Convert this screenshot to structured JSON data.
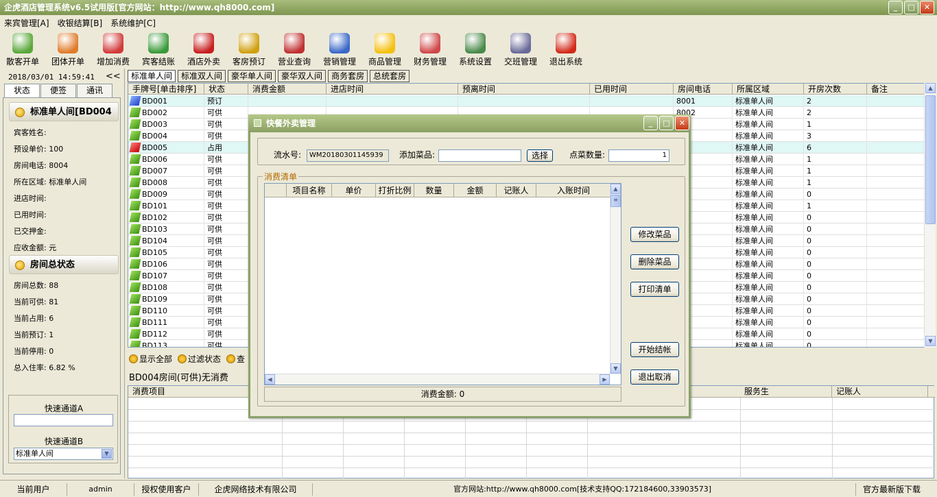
{
  "window": {
    "title": "企虎酒店管理系统v6.5试用版[官方网站：http://www.qh8000.com]"
  },
  "menu": [
    "来宾管理[A]",
    "收银结算[B]",
    "系统维护[C]"
  ],
  "toolbar": [
    {
      "label": "散客开单",
      "icon": "person-icon",
      "color": "#5aa83a"
    },
    {
      "label": "团体开单",
      "icon": "group-icon",
      "color": "#e07b2a"
    },
    {
      "label": "增加消费",
      "icon": "add-icon",
      "color": "#d23a3a"
    },
    {
      "label": "宾客结账",
      "icon": "checkout-arrow-icon",
      "color": "#3a9a3a"
    },
    {
      "label": "酒店外卖",
      "icon": "takeout-icon",
      "color": "#c81e1e"
    },
    {
      "label": "客房预订",
      "icon": "alarm-clock-icon",
      "color": "#d0a010"
    },
    {
      "label": "营业查询",
      "icon": "report-icon",
      "color": "#c03030"
    },
    {
      "label": "营销管理",
      "icon": "people-icon",
      "color": "#3a68c8"
    },
    {
      "label": "商品管理",
      "icon": "star-icon",
      "color": "#f4c010"
    },
    {
      "label": "财务管理",
      "icon": "finance-icon",
      "color": "#d04848"
    },
    {
      "label": "系统设置",
      "icon": "settings-icon",
      "color": "#4a8a4a"
    },
    {
      "label": "交班管理",
      "icon": "handshake-icon",
      "color": "#6a6a9a"
    },
    {
      "label": "退出系统",
      "icon": "power-icon",
      "color": "#d22a1a"
    }
  ],
  "sidebar": {
    "datetime": "2018/03/01 14:59:41",
    "collapse": "<<",
    "tabs": [
      "状态",
      "便签",
      "通讯"
    ],
    "room_section": "标准单人间[BD004",
    "room_info": [
      "宾客姓名:",
      "预设单价: 100",
      "房间电话: 8004",
      "所在区域: 标准单人间",
      "进店时间:",
      "已用时间:",
      "已交押金:",
      "应收金额: 元"
    ],
    "totals_section": "房间总状态",
    "totals": [
      "房间总数: 88",
      "当前可供: 81",
      "当前占用: 6",
      "当前预订: 1",
      "当前停用: 0",
      "总入住率: 6.82 %"
    ],
    "quick_a_label": "快速通道A",
    "quick_a_value": "",
    "quick_b_label": "快速通道B",
    "quick_b_value": "标准单人间"
  },
  "room_tabs": [
    "标准单人间",
    "标准双人间",
    "豪华单人间",
    "豪华双人间",
    "商务套房",
    "总统套房"
  ],
  "room_grid": {
    "headers": [
      "手牌号[单击排序]",
      "状态",
      "消费金额",
      "进店时间",
      "预离时间",
      "已用时间",
      "房间电话",
      "所属区域",
      "开房次数",
      "备注"
    ],
    "rows": [
      {
        "no": "BD001",
        "status": "预订",
        "phone": "8001",
        "area": "标准单人间",
        "count": "2",
        "icon": "blue"
      },
      {
        "no": "BD002",
        "status": "可供",
        "phone": "8002",
        "area": "标准单人间",
        "count": "2",
        "icon": "green"
      },
      {
        "no": "BD003",
        "status": "可供",
        "phone": "3",
        "area": "标准单人间",
        "count": "1",
        "icon": "green"
      },
      {
        "no": "BD004",
        "status": "可供",
        "phone": "4",
        "area": "标准单人间",
        "count": "3",
        "icon": "green"
      },
      {
        "no": "BD005",
        "status": "占用",
        "phone": "5",
        "area": "标准单人间",
        "count": "6",
        "icon": "red"
      },
      {
        "no": "BD006",
        "status": "可供",
        "phone": "",
        "area": "标准单人间",
        "count": "1",
        "icon": "green"
      },
      {
        "no": "BD007",
        "status": "可供",
        "phone": "7",
        "area": "标准单人间",
        "count": "1",
        "icon": "green"
      },
      {
        "no": "BD008",
        "status": "可供",
        "phone": "8",
        "area": "标准单人间",
        "count": "1",
        "icon": "green"
      },
      {
        "no": "BD009",
        "status": "可供",
        "phone": "9",
        "area": "标准单人间",
        "count": "0",
        "icon": "green"
      },
      {
        "no": "BD101",
        "status": "可供",
        "phone": "0",
        "area": "标准单人间",
        "count": "1",
        "icon": "green"
      },
      {
        "no": "BD102",
        "status": "可供",
        "phone": "",
        "area": "标准单人间",
        "count": "0",
        "icon": "green"
      },
      {
        "no": "BD103",
        "status": "可供",
        "phone": "",
        "area": "标准单人间",
        "count": "0",
        "icon": "green"
      },
      {
        "no": "BD104",
        "status": "可供",
        "phone": "",
        "area": "标准单人间",
        "count": "0",
        "icon": "green"
      },
      {
        "no": "BD105",
        "status": "可供",
        "phone": "",
        "area": "标准单人间",
        "count": "0",
        "icon": "green"
      },
      {
        "no": "BD106",
        "status": "可供",
        "phone": "",
        "area": "标准单人间",
        "count": "0",
        "icon": "green"
      },
      {
        "no": "BD107",
        "status": "可供",
        "phone": "",
        "area": "标准单人间",
        "count": "0",
        "icon": "green"
      },
      {
        "no": "BD108",
        "status": "可供",
        "phone": "",
        "area": "标准单人间",
        "count": "0",
        "icon": "green"
      },
      {
        "no": "BD109",
        "status": "可供",
        "phone": "",
        "area": "标准单人间",
        "count": "0",
        "icon": "green"
      },
      {
        "no": "BD110",
        "status": "可供",
        "phone": "",
        "area": "标准单人间",
        "count": "0",
        "icon": "green"
      },
      {
        "no": "BD111",
        "status": "可供",
        "phone": "",
        "area": "标准单人间",
        "count": "0",
        "icon": "green"
      },
      {
        "no": "BD112",
        "status": "可供",
        "phone": "",
        "area": "标准单人间",
        "count": "0",
        "icon": "green"
      },
      {
        "no": "BD113",
        "status": "可供",
        "phone": "",
        "area": "标准单人间",
        "count": "0",
        "icon": "green"
      }
    ],
    "selected_row": "BD005"
  },
  "filters": [
    "显示全部",
    "过滤状态",
    "查"
  ],
  "room_status_text": "BD004房间(可供)无消费",
  "consume_grid": {
    "headers": [
      "消费项目",
      "服务生",
      "记账人"
    ]
  },
  "statusbar": {
    "user_label": "当前用户",
    "user": "admin",
    "license_label": "授权使用客户",
    "company": "企虎网络技术有限公司",
    "website": "官方网站:http://www.qh8000.com[技术支持QQ:172184600,33903573]",
    "download": "官方最新版下载"
  },
  "dialog": {
    "title": "快餐外卖管理",
    "serial_label": "流水号:",
    "serial_value": "WM20180301145939",
    "add_dish_label": "添加菜品:",
    "add_dish_value": "",
    "choose_button": "选择",
    "qty_label": "点菜数量:",
    "qty_value": "1",
    "list_title": "消费清单",
    "columns": [
      "项目名称",
      "单价",
      "打折比例",
      "数量",
      "金额",
      "记账人",
      "入账时间"
    ],
    "total_label": "消费金额: 0",
    "buttons": {
      "edit": "修改菜品",
      "delete": "删除菜品",
      "print": "打印清单",
      "checkout": "开始结帐",
      "cancel": "退出取消"
    }
  }
}
